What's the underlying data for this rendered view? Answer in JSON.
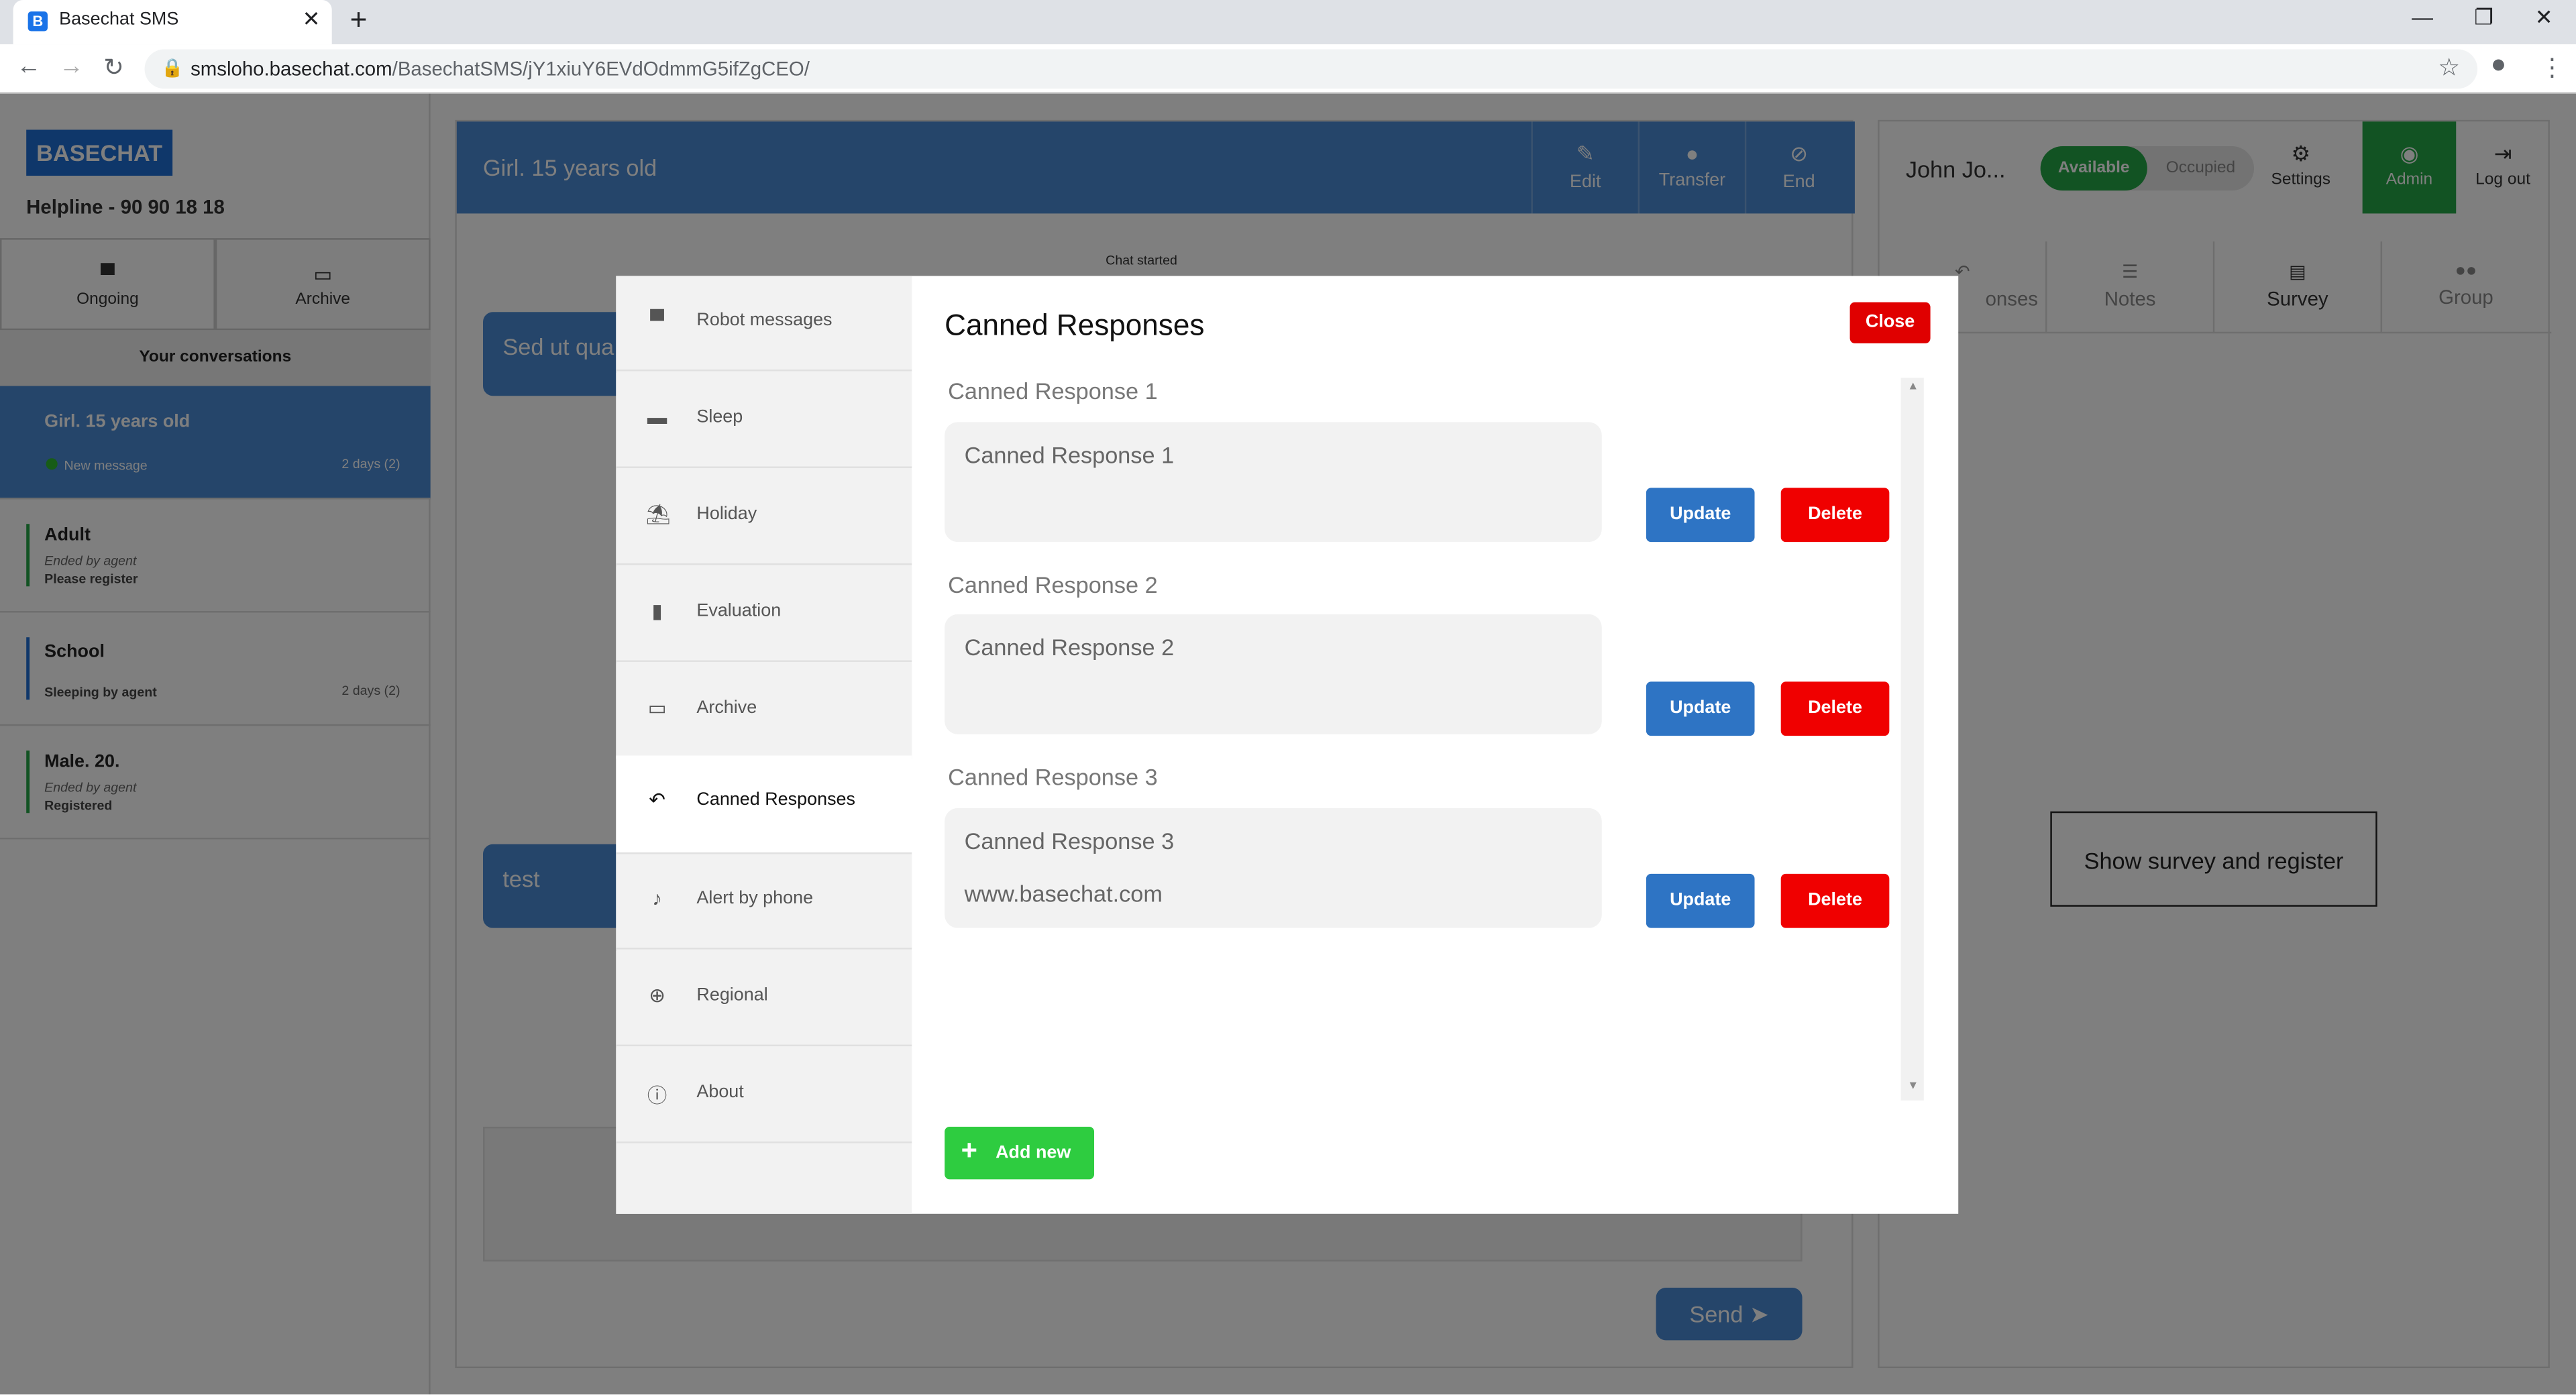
{
  "browser": {
    "tab_title": "Basechat SMS",
    "favicon_letter": "B",
    "url_host": "smsloho.basechat.com",
    "url_path": "/BasechatSMS/jY1xiuY6EVdOdmmG5ifZgCEO/"
  },
  "sidebar": {
    "logo": "BASECHAT",
    "helpline": "Helpline - 90 90 18 18",
    "tabs": [
      {
        "label": "Ongoing",
        "icon": "chat-icon"
      },
      {
        "label": "Archive",
        "icon": "folder-icon"
      }
    ],
    "conversations_header": "Your conversations",
    "conversations": [
      {
        "title": "Girl. 15 years old",
        "status": "New message",
        "time": "2 days (2)"
      },
      {
        "title": "Adult",
        "status": "Ended by agent",
        "note": "Please register"
      },
      {
        "title": "School",
        "note": "Sleeping by agent",
        "time": "2 days (2)"
      },
      {
        "title": "Male. 20.",
        "status": "Ended by agent",
        "note": "Registered"
      }
    ]
  },
  "chat": {
    "title": "Girl. 15 years old",
    "actions": [
      {
        "label": "Edit",
        "icon": "pencil-icon"
      },
      {
        "label": "Transfer",
        "icon": "person-icon"
      },
      {
        "label": "End",
        "icon": "block-icon"
      }
    ],
    "started": "Chat started",
    "messages": [
      "Sed ut qua",
      "test"
    ],
    "send_label": "Send"
  },
  "right_panel": {
    "agent_name": "John Jo...",
    "status_on": "Available",
    "status_off": "Occupied",
    "buttons": [
      {
        "label": "Settings",
        "icon": "gear-icon"
      },
      {
        "label": "Admin",
        "icon": "eye-icon"
      },
      {
        "label": "Log out",
        "icon": "logout-icon"
      }
    ],
    "tabs": [
      {
        "label": "onses",
        "icon": "reply-icon"
      },
      {
        "label": "Notes",
        "icon": "notes-icon"
      },
      {
        "label": "Survey",
        "icon": "survey-icon"
      },
      {
        "label": "Group",
        "icon": "group-icon"
      }
    ],
    "survey_button": "Show survey and register"
  },
  "modal": {
    "title": "Canned Responses",
    "close_label": "Close",
    "menu": [
      {
        "label": "Robot messages",
        "icon": "message-icon"
      },
      {
        "label": "Sleep",
        "icon": "bed-icon"
      },
      {
        "label": "Holiday",
        "icon": "beach-icon"
      },
      {
        "label": "Evaluation",
        "icon": "bar-chart-icon"
      },
      {
        "label": "Archive",
        "icon": "folder-icon"
      },
      {
        "label": "Canned Responses",
        "icon": "reply-icon"
      },
      {
        "label": "Alert by phone",
        "icon": "bell-icon"
      },
      {
        "label": "Regional",
        "icon": "globe-icon"
      },
      {
        "label": "About",
        "icon": "info-icon"
      }
    ],
    "responses": [
      {
        "label": "Canned Response 1",
        "lines": [
          "Canned Response 1"
        ]
      },
      {
        "label": "Canned Response 2",
        "lines": [
          "Canned Response 2"
        ]
      },
      {
        "label": "Canned Response 3",
        "lines": [
          "Canned Response 3",
          "www.basechat.com"
        ]
      }
    ],
    "update_label": "Update",
    "delete_label": "Delete",
    "add_new_label": "Add new"
  },
  "colors": {
    "brand_blue": "#1e6fd4",
    "header_blue": "#4a8ad4",
    "available_green": "#25a746",
    "delete_red": "#f00000",
    "update_blue": "#2e74c4",
    "add_green": "#2ecc40"
  }
}
